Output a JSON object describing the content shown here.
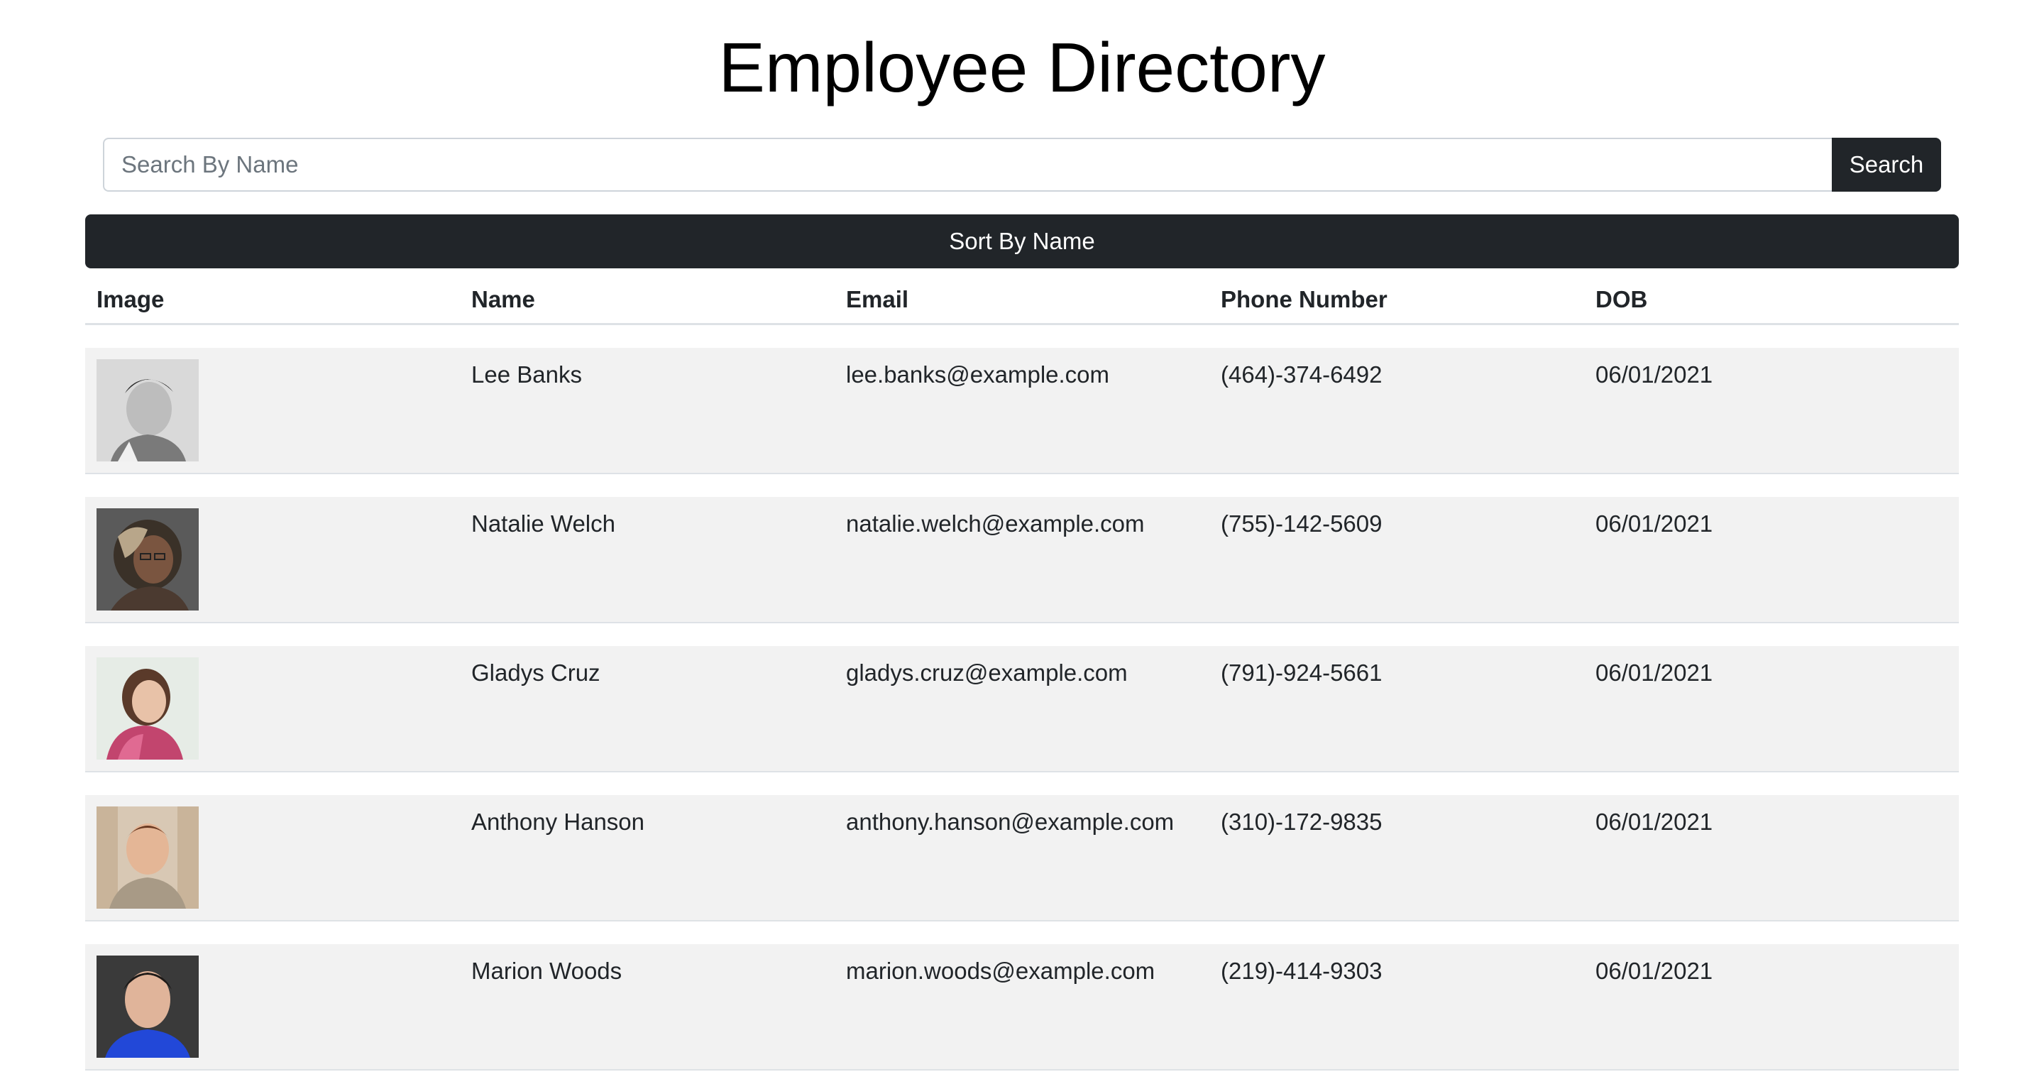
{
  "page": {
    "title": "Employee Directory"
  },
  "search": {
    "placeholder": "Search By Name",
    "value": "",
    "button_label": "Search"
  },
  "sort": {
    "button_label": "Sort By Name"
  },
  "table": {
    "headers": [
      "Image",
      "Name",
      "Email",
      "Phone Number",
      "DOB"
    ],
    "rows": [
      {
        "name": "Lee Banks",
        "email": "lee.banks@example.com",
        "phone": "(464)-374-6492",
        "dob": "06/01/2021"
      },
      {
        "name": "Natalie Welch",
        "email": "natalie.welch@example.com",
        "phone": "(755)-142-5609",
        "dob": "06/01/2021"
      },
      {
        "name": "Gladys Cruz",
        "email": "gladys.cruz@example.com",
        "phone": "(791)-924-5661",
        "dob": "06/01/2021"
      },
      {
        "name": "Anthony Hanson",
        "email": "anthony.hanson@example.com",
        "phone": "(310)-172-9835",
        "dob": "06/01/2021"
      },
      {
        "name": "Marion Woods",
        "email": "marion.woods@example.com",
        "phone": "(219)-414-9303",
        "dob": "06/01/2021"
      }
    ]
  },
  "colors": {
    "dark": "#212529",
    "row_bg": "#f2f2f2",
    "border": "#dee2e6"
  }
}
